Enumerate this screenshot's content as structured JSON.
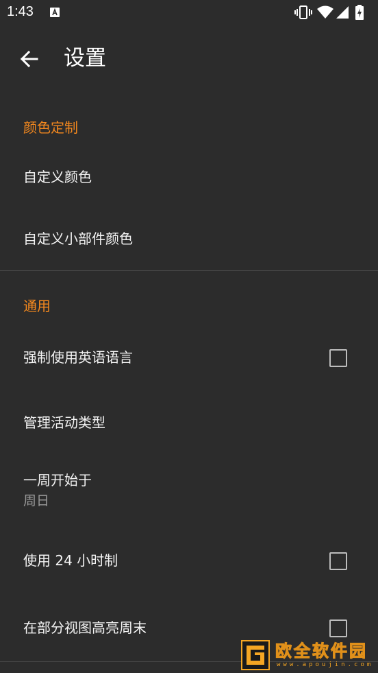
{
  "status_bar": {
    "time": "1:43",
    "icons": [
      "notification-a-icon",
      "vibrate-icon",
      "wifi-icon",
      "cell-signal-icon",
      "battery-charging-icon"
    ]
  },
  "app_bar": {
    "back_icon": "arrow-back-icon",
    "title": "设置"
  },
  "sections": {
    "color": {
      "header": "颜色定制",
      "items": [
        {
          "title": "自定义颜色"
        },
        {
          "title": "自定义小部件颜色"
        }
      ]
    },
    "general": {
      "header": "通用",
      "items": [
        {
          "title": "强制使用英语语言",
          "checkbox": true,
          "checked": false
        },
        {
          "title": "管理活动类型"
        },
        {
          "title": "一周开始于",
          "summary": "周日"
        },
        {
          "title": "使用 24 小时制",
          "checkbox": true,
          "checked": false
        },
        {
          "title": "在部分视图高亮周末",
          "checkbox": true,
          "checked": false
        }
      ]
    }
  },
  "watermark": {
    "text": "欧全软件园",
    "url": "www.apoujin.com"
  },
  "colors": {
    "background": "#2c2c2c",
    "accent": "#f5891e",
    "text_primary": "#f3f3f3",
    "text_secondary": "#9a9a9a",
    "divider": "#484848",
    "checkbox_border": "#bdbdbd"
  }
}
